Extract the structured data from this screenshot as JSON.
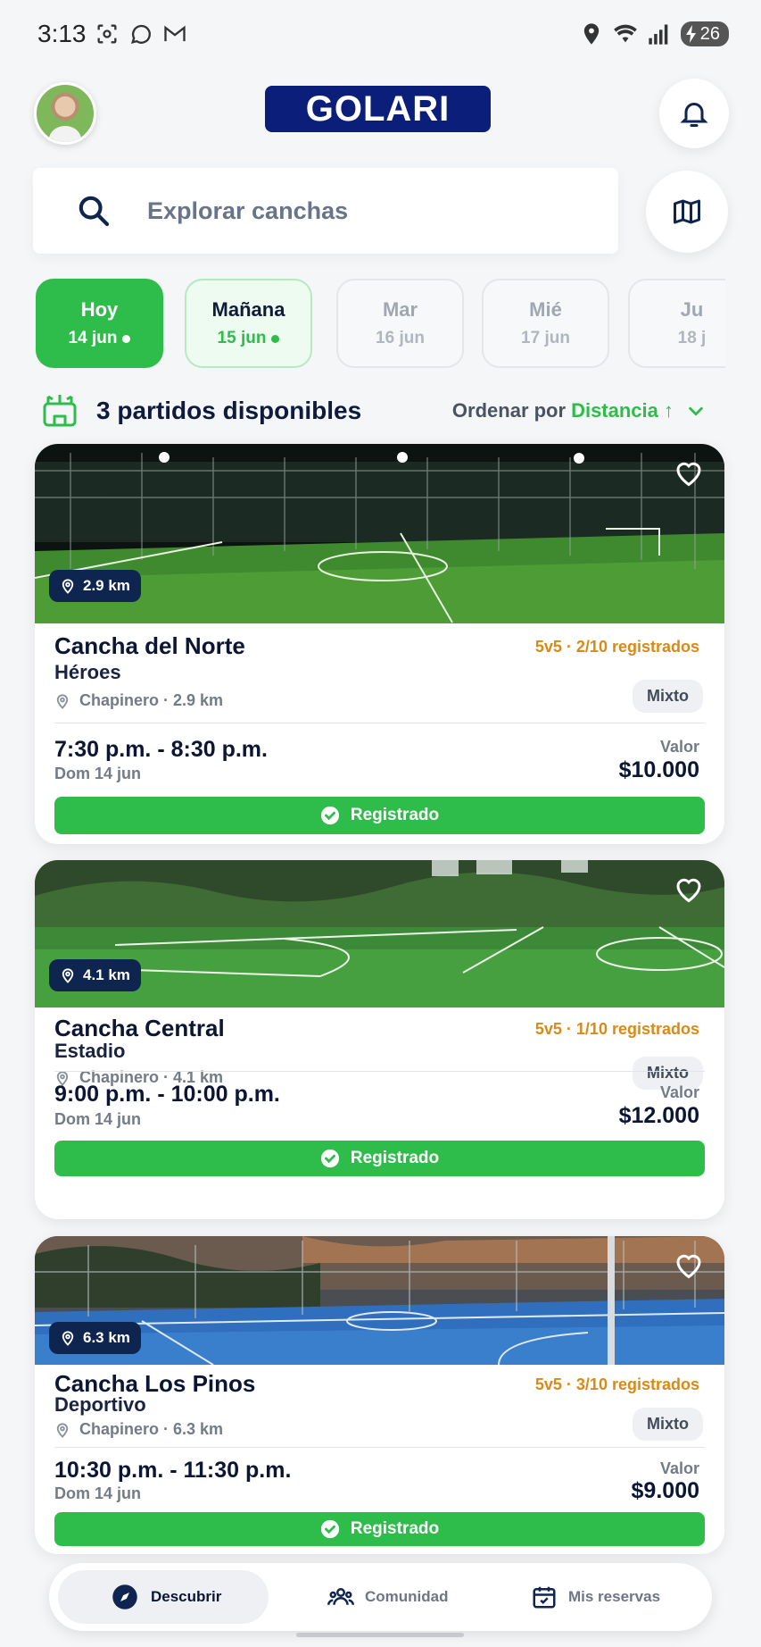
{
  "status_bar": {
    "time": "3:13",
    "battery": "26"
  },
  "header": {
    "logo_text": "GOLARI",
    "icons": [
      "avatar",
      "bell-icon",
      "map-icon"
    ]
  },
  "search": {
    "placeholder": "Explorar canchas"
  },
  "dates": [
    {
      "day": "Hoy",
      "date": "14 jun",
      "dot": true,
      "state": "active"
    },
    {
      "day": "Mañana",
      "date": "15 jun",
      "dot": true,
      "state": "tomorrow"
    },
    {
      "day": "Mar",
      "date": "16 jun",
      "dot": false,
      "state": "inactive"
    },
    {
      "day": "Mié",
      "date": "17 jun",
      "dot": false,
      "state": "inactive"
    },
    {
      "day": "Ju",
      "date": "18 j",
      "dot": false,
      "state": "inactive"
    }
  ],
  "results": {
    "count_text": "3 partidos disponibles",
    "sort_label": "Ordenar por",
    "sort_value": "Distancia ↑"
  },
  "cards": [
    {
      "distance": "2.9 km",
      "name": "Cancha del Norte",
      "subtitle": "Héroes",
      "location": "Chapinero · 2.9 km",
      "registered": "5v5 · 2/10 registrados",
      "tag": "Mixto",
      "time": "7:30 p.m. - 8:30 p.m.",
      "date": "Dom 14 jun",
      "value_label": "Valor",
      "price": "$10.000",
      "button": "Registrado"
    },
    {
      "distance": "4.1 km",
      "name": "Cancha Central",
      "subtitle": "Estadio",
      "location": "Chapinero · 4.1 km",
      "registered": "5v5 · 1/10 registrados",
      "tag": "Mixto",
      "time": "9:00 p.m. - 10:00 p.m.",
      "date": "Dom 14 jun",
      "value_label": "Valor",
      "price": "$12.000",
      "button": "Registrado"
    },
    {
      "distance": "6.3 km",
      "name": "Cancha Los Pinos",
      "subtitle": "Deportivo",
      "location": "Chapinero · 6.3 km",
      "registered": "5v5 · 3/10 registrados",
      "tag": "Mixto",
      "time": "10:30 p.m. - 11:30 p.m.",
      "date": "Dom 14 jun",
      "value_label": "Valor",
      "price": "$9.000",
      "button": "Registrado"
    }
  ],
  "bottom_nav": [
    {
      "label": "Descubrir",
      "icon": "compass-icon",
      "active": true
    },
    {
      "label": "Comunidad",
      "icon": "people-icon",
      "active": false
    },
    {
      "label": "Mis reservas",
      "icon": "calendar-check-icon",
      "active": false
    }
  ],
  "colors": {
    "primary_green": "#2ebd4a",
    "navy": "#0e2550",
    "logo_blue": "#0b1f7a",
    "registered_orange": "#d98a16"
  }
}
